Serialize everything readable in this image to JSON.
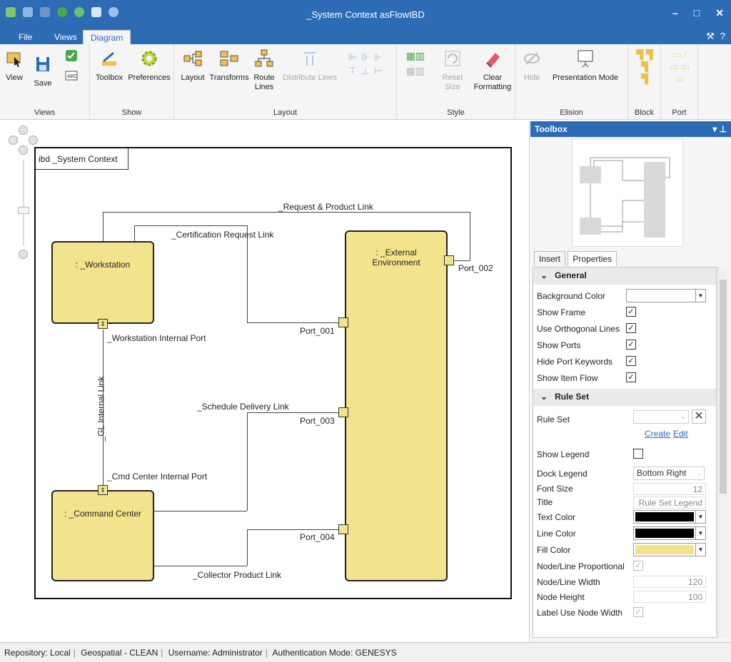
{
  "window": {
    "title": "_System Context asFlowIBD"
  },
  "menu": {
    "tabs": [
      "File",
      "Views",
      "Diagram"
    ],
    "active": "Diagram"
  },
  "ribbon": {
    "views": {
      "label": "Views",
      "view": "View",
      "save": "Save"
    },
    "show": {
      "label": "Show",
      "toolbox": "Toolbox",
      "preferences": "Preferences"
    },
    "layout": {
      "label": "Layout",
      "layout": "Layout",
      "transforms": "Transforms",
      "route": "Route Lines",
      "distribute": "Distribute Lines"
    },
    "style": {
      "label": "Style",
      "reset": "Reset Size",
      "clear": "Clear Formatting"
    },
    "elision": {
      "label": "Elision",
      "hide": "Hide",
      "presentation": "Presentation Mode"
    },
    "block": {
      "label": "Block"
    },
    "port": {
      "label": "Port"
    }
  },
  "diagram": {
    "frame_label": "ibd _System Context",
    "blocks": {
      "workstation": ": _Workstation",
      "external_1": ": _External",
      "external_2": "Environment",
      "command": ": _Command Center"
    },
    "labels": {
      "request": "_Request & Product Link",
      "certification": "_Certification Request Link",
      "port002": "Port_002",
      "port001": "Port_001",
      "ws_internal": "_Workstation Internal Port",
      "gl_internal": "_GL Internal Link",
      "schedule": "_Schedule Delivery Link",
      "port003": "Port_003",
      "cmd_internal": "_Cmd Center Internal Port",
      "port004": "Port_004",
      "collector": "_Collector Product Link"
    }
  },
  "panel": {
    "title": "Toolbox",
    "tabs": [
      "Insert",
      "Properties"
    ],
    "general": "General",
    "props": {
      "background_color": "Background Color",
      "show_frame": "Show Frame",
      "ortho": "Use Orthogonal Lines",
      "show_ports": "Show Ports",
      "hide_port_kw": "Hide Port Keywords",
      "show_item_flow": "Show Item Flow"
    },
    "ruleset_section": "Rule Set",
    "ruleset": {
      "rule_set": "Rule Set",
      "create": "Create",
      "edit": "Edit",
      "show_legend": "Show Legend",
      "dock_legend": "Dock Legend",
      "dock_value": "Bottom Right",
      "font_size": "Font Size",
      "font_size_value": "12",
      "title": "Title",
      "title_value": "Rule Set Legend",
      "text_color": "Text Color",
      "line_color": "Line Color",
      "fill_color": "Fill Color",
      "proportional": "Node/Line Proportional",
      "node_width": "Node/Line Width",
      "node_width_value": "120",
      "node_height": "Node Height",
      "node_height_value": "100",
      "label_width": "Label Use Node Width"
    },
    "colors": {
      "text": "#000000",
      "line": "#000000",
      "fill": "#f2e48d"
    }
  },
  "status": {
    "repository": "Repository: Local",
    "project": "Geospatial - CLEAN",
    "user": "Username: Administrator",
    "auth": "Authentication Mode: GENESYS"
  }
}
